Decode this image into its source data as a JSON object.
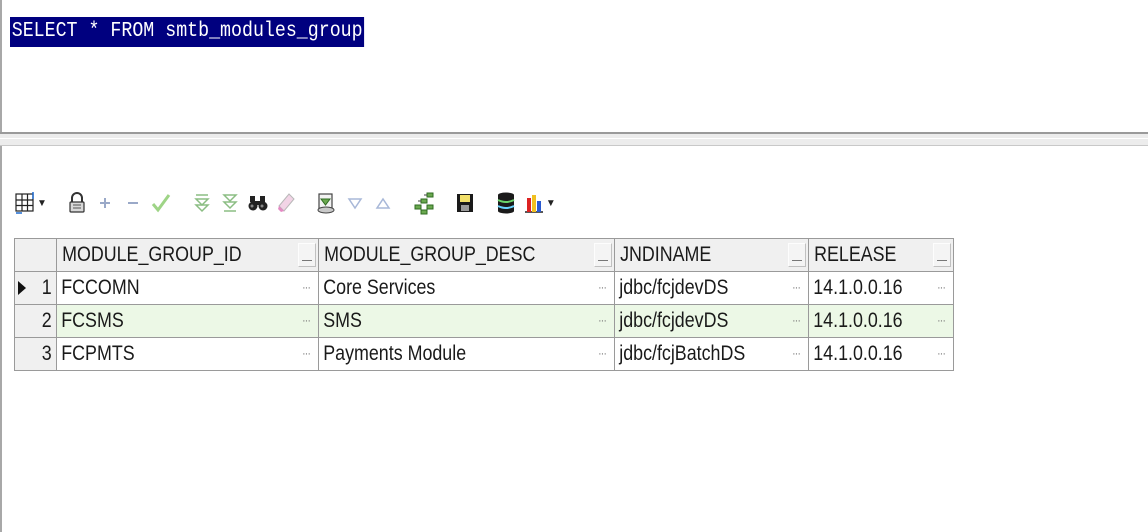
{
  "editor": {
    "sql": "SELECT * FROM smtb_modules_group"
  },
  "toolbar": {
    "buttons": [
      {
        "name": "grid-view-icon"
      },
      {
        "name": "lock-icon"
      },
      {
        "name": "add-record-icon"
      },
      {
        "name": "delete-record-icon"
      },
      {
        "name": "post-changes-icon"
      },
      {
        "name": "filter-icon"
      },
      {
        "name": "clear-filter-icon"
      },
      {
        "name": "find-binoculars-icon"
      },
      {
        "name": "clear-find-icon"
      },
      {
        "name": "query-by-example-icon"
      },
      {
        "name": "next-triangle-icon"
      },
      {
        "name": "previous-triangle-icon"
      },
      {
        "name": "tree-view-icon"
      },
      {
        "name": "save-icon"
      },
      {
        "name": "export-database-icon"
      },
      {
        "name": "chart-icon"
      }
    ]
  },
  "grid": {
    "columns": [
      "MODULE_GROUP_ID",
      "MODULE_GROUP_DESC",
      "JNDINAME",
      "RELEASE"
    ],
    "rows": [
      {
        "num": "1",
        "cells": [
          "FCCOMN",
          "Core Services",
          "jdbc/fcjdevDS",
          "14.1.0.0.16"
        ]
      },
      {
        "num": "2",
        "cells": [
          "FCSMS",
          "SMS",
          "jdbc/fcjdevDS",
          "14.1.0.0.16"
        ]
      },
      {
        "num": "3",
        "cells": [
          "FCPMTS",
          "Payments Module",
          "jdbc/fcjBatchDS",
          "14.1.0.0.16"
        ]
      }
    ],
    "current_row": "1",
    "ellipsis": "···",
    "colors": {
      "alt_row": "#ecf8e6",
      "selection": "#00007f",
      "grid_line": "#9a9a9a"
    }
  }
}
